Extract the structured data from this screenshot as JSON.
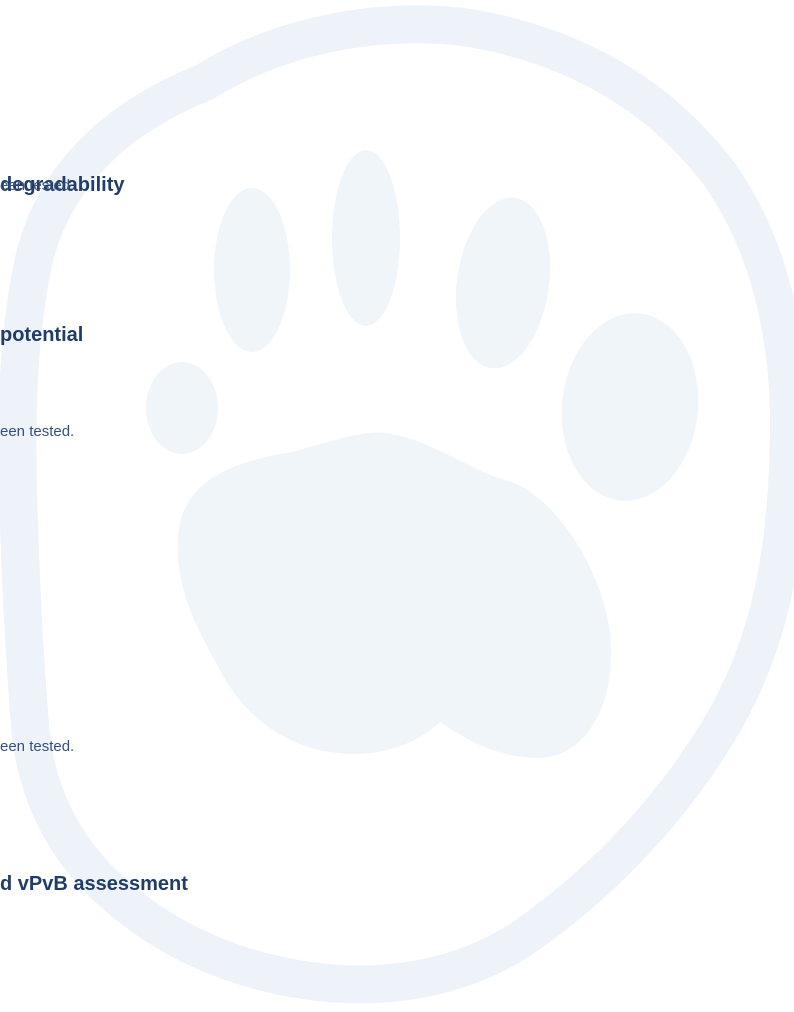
{
  "colors": {
    "heading": "#1f3c6b",
    "body": "#35507f",
    "watermark_fill": "#f0f5fa",
    "watermark_ring": "#edf3f9"
  },
  "watermark": {
    "icon": "paw-print-icon"
  },
  "content": {
    "lines": [
      {
        "kind": "heading",
        "text": "degradability"
      },
      {
        "kind": "body",
        "text": "een tested."
      },
      {
        "kind": "heading",
        "text": "potential"
      },
      {
        "kind": "body",
        "text": "een tested."
      },
      {
        "kind": "body",
        "text": "een tested."
      },
      {
        "kind": "heading",
        "text": "d vPvB assessment"
      }
    ]
  }
}
